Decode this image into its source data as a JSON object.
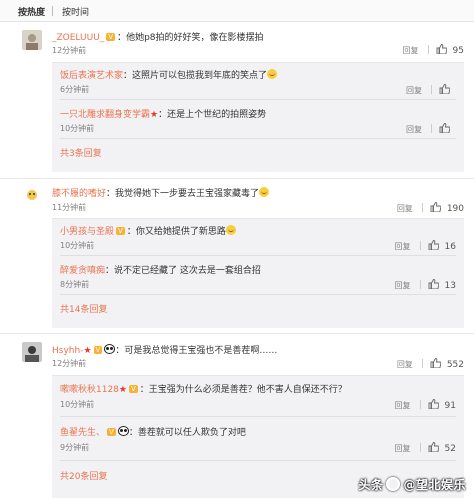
{
  "tabs": {
    "hot": "按热度",
    "time": "按时间"
  },
  "actions": {
    "reply": "回复"
  },
  "comments": [
    {
      "user": "_ZOELUUU_",
      "text": "：他她p8拍的好好笑，像在影楼摆拍",
      "time": "12分钟前",
      "likes": "95",
      "replies": [
        {
          "user": "饭后表演艺术家",
          "text": "：这照片可以包揽我到年底的笑点了",
          "time": "6分钟前",
          "likes": ""
        },
        {
          "user": "一只北雕求翻身变学霸",
          "text": "：还是上个世纪的拍照姿势",
          "time": "10分钟前",
          "likes": ""
        }
      ],
      "more": "共3条回复"
    },
    {
      "user": "膝不履的嗜好",
      "text": "：我觉得她下一步要去王宝强家藏毒了",
      "time": "11分钟前",
      "likes": "190",
      "replies": [
        {
          "user": "小男孩与圣殿",
          "text": "：你又给她提供了新思路",
          "time": "10分钟前",
          "likes": "16"
        },
        {
          "user": "醉爱贪嗔痴",
          "text": "：说不定已经藏了 这次去是一套组合招",
          "time": "8分钟前",
          "likes": "13"
        }
      ],
      "more": "共14条回复"
    },
    {
      "user": "Hsyhh-",
      "text": "：可是我总觉得王宝强也不是善茬啊……",
      "time": "12分钟前",
      "likes": "552",
      "replies": [
        {
          "user": "嗽嗽秋秋1128",
          "text": "：王宝强为什么必须是善茬？他不害人自保还不行？",
          "time": "10分钟前",
          "likes": "91"
        },
        {
          "user": "鱼翟先生、",
          "text": "：善茬就可以任人欺负了对吧",
          "time": "9分钟前",
          "likes": "52"
        }
      ],
      "more": "共20条回复"
    }
  ],
  "watermark": {
    "prefix": "头条",
    "at": "@",
    "name": "望北娱乐"
  },
  "colors": {
    "link": "#eb7350",
    "gray": "#808080",
    "reply_bg": "#f2f2f5"
  }
}
